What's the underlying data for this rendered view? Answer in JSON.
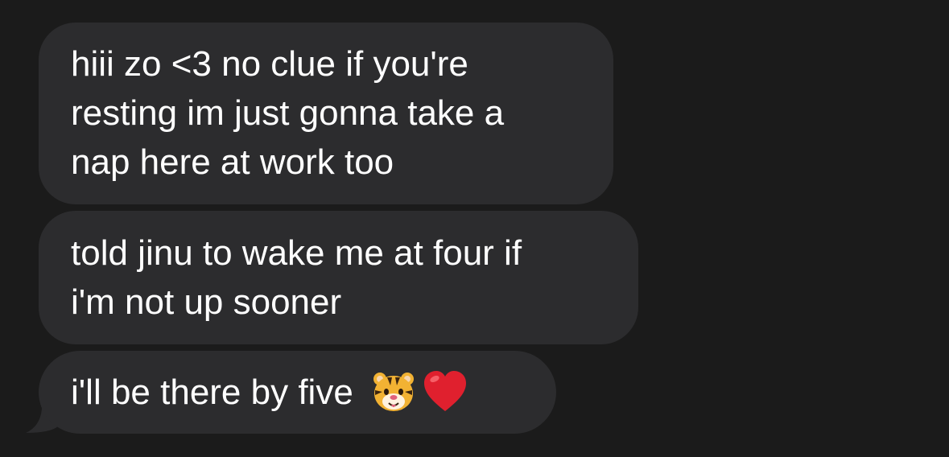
{
  "messages": [
    {
      "lines": [
        "hiii zo <3 no clue if you're",
        "resting im just gonna take a",
        "nap here at work too"
      ]
    },
    {
      "lines": [
        "told jinu to wake me at four if",
        "i'm not up sooner"
      ]
    },
    {
      "text": "i'll be there by five",
      "emojis": [
        "tiger-face-icon",
        "red-heart-icon"
      ]
    }
  ],
  "colors": {
    "background": "#1b1b1b",
    "bubble": "#2c2c2e",
    "text": "#ffffff",
    "heart": "#e0202e",
    "tiger_fur": "#f2b233"
  }
}
